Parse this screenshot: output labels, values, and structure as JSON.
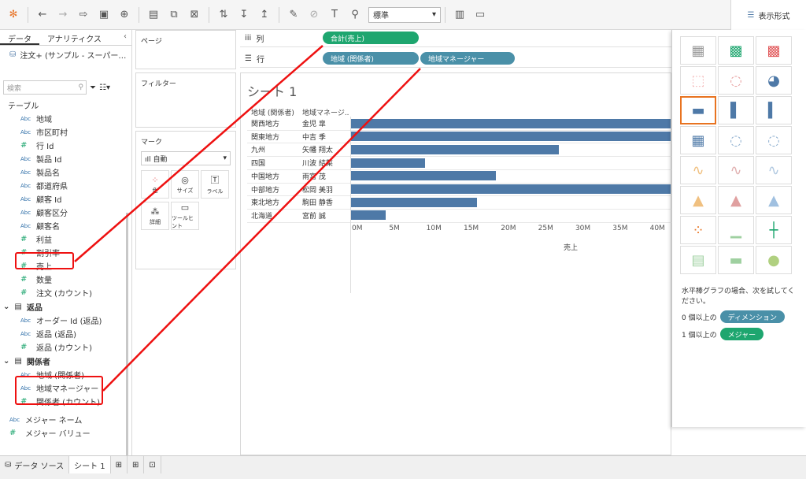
{
  "toolbar": {
    "zoom_select": "標準",
    "show_me_label": "表示形式"
  },
  "left": {
    "tab_data": "データ",
    "tab_analytics": "アナリティクス",
    "datasource": "注文+ (サンプル - スーパー…",
    "search_placeholder": "検索",
    "tables_label": "テーブル",
    "fields": [
      {
        "type": "Abc",
        "name": "地域"
      },
      {
        "type": "Abc",
        "name": "市区町村"
      },
      {
        "type": "#",
        "name": "行 Id"
      },
      {
        "type": "Abc",
        "name": "製品 Id"
      },
      {
        "type": "Abc",
        "name": "製品名"
      },
      {
        "type": "Abc",
        "name": "都道府県"
      },
      {
        "type": "Abc",
        "name": "顧客 Id"
      },
      {
        "type": "Abc",
        "name": "顧客区分"
      },
      {
        "type": "Abc",
        "name": "顧客名"
      },
      {
        "type": "#",
        "name": "利益"
      },
      {
        "type": "#",
        "name": "割引率"
      },
      {
        "type": "#",
        "name": "売上"
      },
      {
        "type": "#",
        "name": "数量"
      },
      {
        "type": "#",
        "name": "注文 (カウント)"
      }
    ],
    "group_returns": "返品",
    "returns_fields": [
      {
        "type": "Abc",
        "name": "オーダー Id (返品)"
      },
      {
        "type": "Abc",
        "name": "返品 (返品)"
      },
      {
        "type": "#",
        "name": "返品 (カウント)"
      }
    ],
    "group_people": "関係者",
    "people_fields": [
      {
        "type": "Abc",
        "name": "地域 (関係者)"
      },
      {
        "type": "Abc",
        "name": "地域マネージャー"
      },
      {
        "type": "#",
        "name": "関係者 (カウント)"
      }
    ],
    "measure_names": "メジャー ネーム",
    "measure_values": "メジャー バリュー"
  },
  "shelves": {
    "pages_label": "ページ",
    "filters_label": "フィルター",
    "marks_label": "マーク",
    "marks_type": "自動",
    "mark_color": "色",
    "mark_size": "サイズ",
    "mark_label": "ラベル",
    "mark_detail": "詳細",
    "mark_tooltip": "ツールヒント",
    "columns_label": "列",
    "rows_label": "行",
    "columns_pill": "合計(売上)",
    "rows_pill_1": "地域 (関係者)",
    "rows_pill_2": "地域マネージャー"
  },
  "viz": {
    "sheet_title": "シート 1",
    "col_header_1": "地域 (関係者)",
    "col_header_2": "地域マネージ..",
    "xlabel": "売上"
  },
  "chart_data": {
    "type": "bar",
    "categories": [
      "関西地方",
      "関東地方",
      "九州",
      "四国",
      "中国地方",
      "中部地方",
      "東北地方",
      "北海道"
    ],
    "managers": [
      "金児 皐",
      "中吉 季",
      "矢幡 翔太",
      "川波 結菜",
      "雨宮 茂",
      "松岡 美羽",
      "駒田 静香",
      "宮前 誠"
    ],
    "values": [
      44000000,
      44000000,
      28000000,
      10000000,
      19500000,
      43800000,
      17000000,
      4800000
    ],
    "ticks": [
      "0M",
      "5M",
      "10M",
      "15M",
      "20M",
      "25M",
      "30M",
      "35M",
      "40M"
    ],
    "xlabel": "売上",
    "xlim": [
      0,
      43000000
    ]
  },
  "showme": {
    "hint": "水平棒グラフの場合、次を試してください。",
    "dim_prefix": "0 個以上の",
    "dim_pill": "ディメンション",
    "mea_prefix": "1 個以上の",
    "mea_pill": "メジャー"
  },
  "bottom": {
    "datasource_tab": "データ ソース",
    "sheet_tab": "シート 1"
  },
  "colors": {
    "bar": "#4e79a7",
    "measure_pill": "#1ea66f",
    "dimension_pill": "#4a90a8",
    "highlight": "#e11111"
  }
}
